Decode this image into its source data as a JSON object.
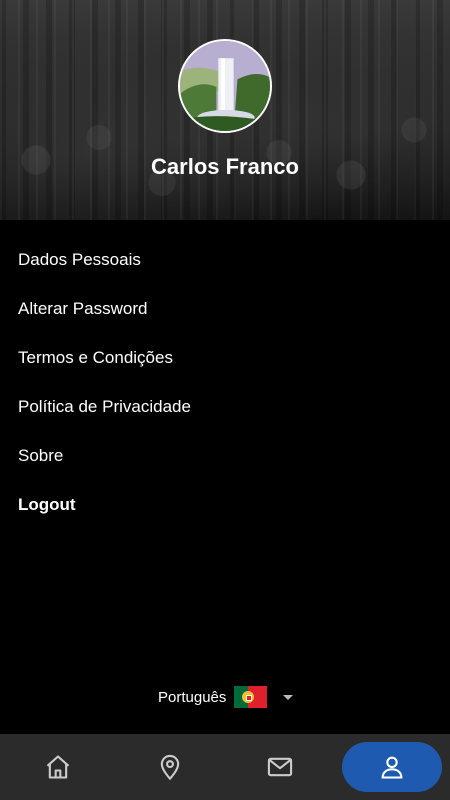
{
  "profile": {
    "name": "Carlos Franco"
  },
  "menu": {
    "items": [
      {
        "label": "Dados Pessoais"
      },
      {
        "label": "Alterar Password"
      },
      {
        "label": "Termos e Condições"
      },
      {
        "label": "Política de Privacidade"
      },
      {
        "label": "Sobre"
      },
      {
        "label": "Logout"
      }
    ]
  },
  "language": {
    "selected": "Português",
    "flag_icon": "portugal-flag-icon"
  },
  "bottom_nav": {
    "items": [
      {
        "icon": "home-icon",
        "active": false
      },
      {
        "icon": "map-pin-icon",
        "active": false
      },
      {
        "icon": "mail-icon",
        "active": false
      },
      {
        "icon": "user-icon",
        "active": true
      }
    ]
  },
  "colors": {
    "background": "#000000",
    "nav_background": "#2b2b2b",
    "active_accent": "#1e5bb0",
    "icon": "#cccccc"
  }
}
